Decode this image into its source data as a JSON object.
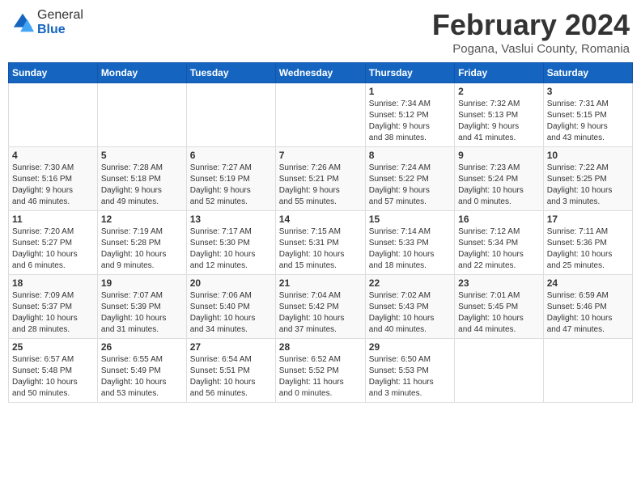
{
  "header": {
    "logo_general": "General",
    "logo_blue": "Blue",
    "month_title": "February 2024",
    "location": "Pogana, Vaslui County, Romania"
  },
  "weekdays": [
    "Sunday",
    "Monday",
    "Tuesday",
    "Wednesday",
    "Thursday",
    "Friday",
    "Saturday"
  ],
  "weeks": [
    [
      {
        "day": "",
        "info": ""
      },
      {
        "day": "",
        "info": ""
      },
      {
        "day": "",
        "info": ""
      },
      {
        "day": "",
        "info": ""
      },
      {
        "day": "1",
        "info": "Sunrise: 7:34 AM\nSunset: 5:12 PM\nDaylight: 9 hours\nand 38 minutes."
      },
      {
        "day": "2",
        "info": "Sunrise: 7:32 AM\nSunset: 5:13 PM\nDaylight: 9 hours\nand 41 minutes."
      },
      {
        "day": "3",
        "info": "Sunrise: 7:31 AM\nSunset: 5:15 PM\nDaylight: 9 hours\nand 43 minutes."
      }
    ],
    [
      {
        "day": "4",
        "info": "Sunrise: 7:30 AM\nSunset: 5:16 PM\nDaylight: 9 hours\nand 46 minutes."
      },
      {
        "day": "5",
        "info": "Sunrise: 7:28 AM\nSunset: 5:18 PM\nDaylight: 9 hours\nand 49 minutes."
      },
      {
        "day": "6",
        "info": "Sunrise: 7:27 AM\nSunset: 5:19 PM\nDaylight: 9 hours\nand 52 minutes."
      },
      {
        "day": "7",
        "info": "Sunrise: 7:26 AM\nSunset: 5:21 PM\nDaylight: 9 hours\nand 55 minutes."
      },
      {
        "day": "8",
        "info": "Sunrise: 7:24 AM\nSunset: 5:22 PM\nDaylight: 9 hours\nand 57 minutes."
      },
      {
        "day": "9",
        "info": "Sunrise: 7:23 AM\nSunset: 5:24 PM\nDaylight: 10 hours\nand 0 minutes."
      },
      {
        "day": "10",
        "info": "Sunrise: 7:22 AM\nSunset: 5:25 PM\nDaylight: 10 hours\nand 3 minutes."
      }
    ],
    [
      {
        "day": "11",
        "info": "Sunrise: 7:20 AM\nSunset: 5:27 PM\nDaylight: 10 hours\nand 6 minutes."
      },
      {
        "day": "12",
        "info": "Sunrise: 7:19 AM\nSunset: 5:28 PM\nDaylight: 10 hours\nand 9 minutes."
      },
      {
        "day": "13",
        "info": "Sunrise: 7:17 AM\nSunset: 5:30 PM\nDaylight: 10 hours\nand 12 minutes."
      },
      {
        "day": "14",
        "info": "Sunrise: 7:15 AM\nSunset: 5:31 PM\nDaylight: 10 hours\nand 15 minutes."
      },
      {
        "day": "15",
        "info": "Sunrise: 7:14 AM\nSunset: 5:33 PM\nDaylight: 10 hours\nand 18 minutes."
      },
      {
        "day": "16",
        "info": "Sunrise: 7:12 AM\nSunset: 5:34 PM\nDaylight: 10 hours\nand 22 minutes."
      },
      {
        "day": "17",
        "info": "Sunrise: 7:11 AM\nSunset: 5:36 PM\nDaylight: 10 hours\nand 25 minutes."
      }
    ],
    [
      {
        "day": "18",
        "info": "Sunrise: 7:09 AM\nSunset: 5:37 PM\nDaylight: 10 hours\nand 28 minutes."
      },
      {
        "day": "19",
        "info": "Sunrise: 7:07 AM\nSunset: 5:39 PM\nDaylight: 10 hours\nand 31 minutes."
      },
      {
        "day": "20",
        "info": "Sunrise: 7:06 AM\nSunset: 5:40 PM\nDaylight: 10 hours\nand 34 minutes."
      },
      {
        "day": "21",
        "info": "Sunrise: 7:04 AM\nSunset: 5:42 PM\nDaylight: 10 hours\nand 37 minutes."
      },
      {
        "day": "22",
        "info": "Sunrise: 7:02 AM\nSunset: 5:43 PM\nDaylight: 10 hours\nand 40 minutes."
      },
      {
        "day": "23",
        "info": "Sunrise: 7:01 AM\nSunset: 5:45 PM\nDaylight: 10 hours\nand 44 minutes."
      },
      {
        "day": "24",
        "info": "Sunrise: 6:59 AM\nSunset: 5:46 PM\nDaylight: 10 hours\nand 47 minutes."
      }
    ],
    [
      {
        "day": "25",
        "info": "Sunrise: 6:57 AM\nSunset: 5:48 PM\nDaylight: 10 hours\nand 50 minutes."
      },
      {
        "day": "26",
        "info": "Sunrise: 6:55 AM\nSunset: 5:49 PM\nDaylight: 10 hours\nand 53 minutes."
      },
      {
        "day": "27",
        "info": "Sunrise: 6:54 AM\nSunset: 5:51 PM\nDaylight: 10 hours\nand 56 minutes."
      },
      {
        "day": "28",
        "info": "Sunrise: 6:52 AM\nSunset: 5:52 PM\nDaylight: 11 hours\nand 0 minutes."
      },
      {
        "day": "29",
        "info": "Sunrise: 6:50 AM\nSunset: 5:53 PM\nDaylight: 11 hours\nand 3 minutes."
      },
      {
        "day": "",
        "info": ""
      },
      {
        "day": "",
        "info": ""
      }
    ]
  ]
}
